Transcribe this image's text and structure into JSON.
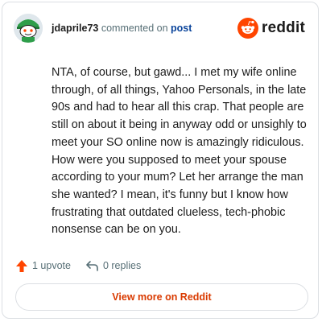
{
  "comment": {
    "username": "jdaprile73",
    "action_text": "commented on",
    "target_text": "post",
    "body": "NTA, of course, but gawd... I met my wife online through, of all things, Yahoo Personals, in the late 90s and had to hear all this crap. That people are still on about it being in anyway odd or unsighly to meet your SO online now is amazingly ridiculous. How were you supposed to meet your spouse according to your mum? Let her arrange the man she wanted? I mean, it's funny but I know how frustrating that outdated clueless, tech-phobic nonsense can be on you."
  },
  "brand": {
    "name": "reddit",
    "logo_icon": "reddit-snoo-icon",
    "accent": "#ff4500"
  },
  "actions": {
    "upvote_label": "1 upvote",
    "upvote_icon": "upvote-arrow-icon",
    "reply_label": "0 replies",
    "reply_icon": "reply-arrow-icon"
  },
  "footer": {
    "view_more_label": "View more on Reddit",
    "link_color": "#d93a00"
  }
}
